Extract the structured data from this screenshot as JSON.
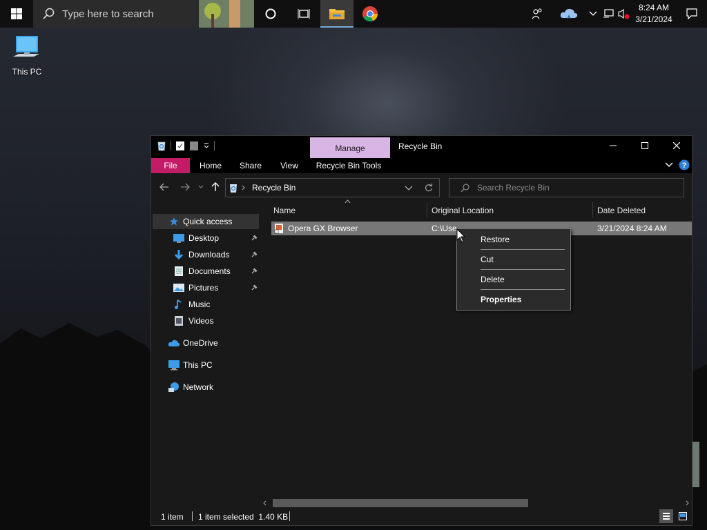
{
  "taskbar": {
    "search_placeholder": "Type here to search",
    "time": "8:24 AM",
    "date": "3/21/2024"
  },
  "desktop": {
    "icons": [
      {
        "label": "This PC",
        "icon": "computer-icon"
      }
    ]
  },
  "window": {
    "title": "Recycle Bin",
    "contextual_tab": "Manage",
    "ribbon_tabs": [
      "File",
      "Home",
      "Share",
      "View",
      "Recycle Bin Tools"
    ],
    "address": {
      "location": "Recycle Bin"
    },
    "search_placeholder": "Search Recycle Bin",
    "nav": {
      "quick_access": "Quick access",
      "pinned": [
        {
          "label": "Desktop",
          "icon": "desktop-folder-icon",
          "pinned": true
        },
        {
          "label": "Downloads",
          "icon": "download-arrow-icon",
          "pinned": true
        },
        {
          "label": "Documents",
          "icon": "document-icon",
          "pinned": true
        },
        {
          "label": "Pictures",
          "icon": "pictures-icon",
          "pinned": true
        },
        {
          "label": "Music",
          "icon": "music-note-icon",
          "pinned": false
        },
        {
          "label": "Videos",
          "icon": "video-icon",
          "pinned": false
        }
      ],
      "onedrive": "OneDrive",
      "this_pc": "This PC",
      "network": "Network"
    },
    "columns": {
      "name": "Name",
      "original_location": "Original Location",
      "date_deleted": "Date Deleted"
    },
    "files": [
      {
        "name": "Opera GX Browser",
        "original_location": "C:\\Use",
        "date_deleted": "3/21/2024 8:24 AM"
      }
    ],
    "status": {
      "count": "1 item",
      "selection": "1 item selected  1.40 KB"
    }
  },
  "context_menu": {
    "items": [
      "Restore",
      "Cut",
      "Delete",
      "Properties"
    ],
    "default_item": "Properties"
  },
  "colors": {
    "file_tab": "#c21c67",
    "manage_tab": "#d9b5e6",
    "selection": "#777777",
    "accent": "#2d7fd3"
  }
}
